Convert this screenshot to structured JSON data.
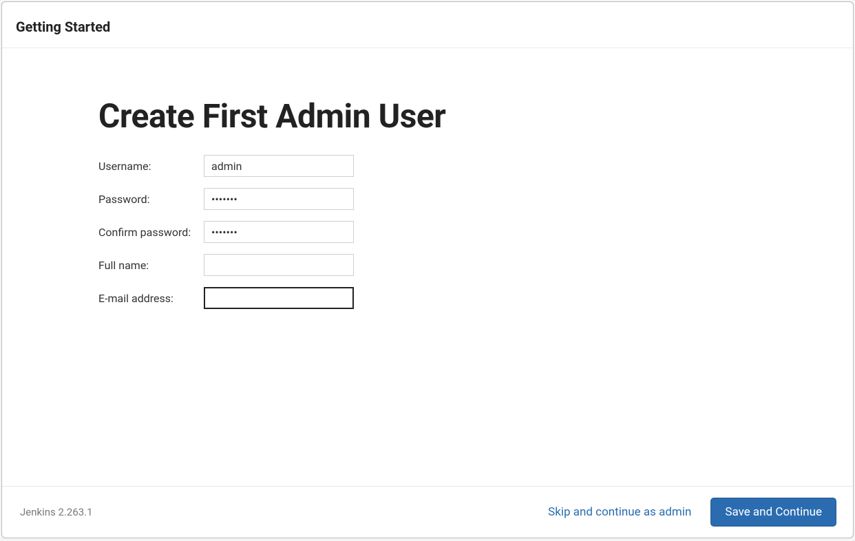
{
  "header": {
    "title": "Getting Started"
  },
  "page": {
    "title": "Create First Admin User"
  },
  "form": {
    "username": {
      "label": "Username:",
      "value": "admin"
    },
    "password": {
      "label": "Password:",
      "value": "•••••••"
    },
    "confirm_password": {
      "label": "Confirm password:",
      "value": "•••••••"
    },
    "full_name": {
      "label": "Full name:",
      "value": ""
    },
    "email": {
      "label": "E-mail address:",
      "value": ""
    }
  },
  "footer": {
    "version": "Jenkins 2.263.1",
    "skip_label": "Skip and continue as admin",
    "save_label": "Save and Continue"
  }
}
